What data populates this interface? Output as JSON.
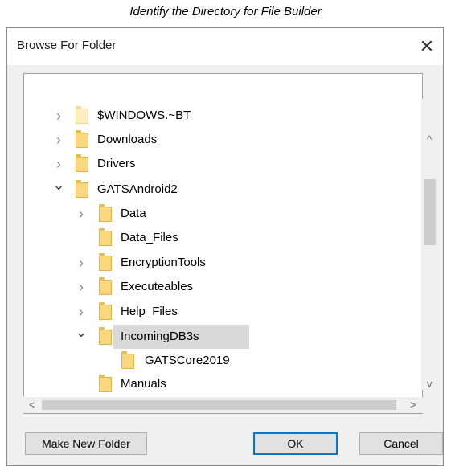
{
  "caption": "Identify the Directory for File Builder",
  "dialog": {
    "title": "Browse For Folder",
    "close_glyph": "✕"
  },
  "tree": {
    "items": [
      {
        "label": "$WINDOWS.~BT",
        "expander": "›"
      },
      {
        "label": "Downloads",
        "expander": "›"
      },
      {
        "label": "Drivers",
        "expander": "›"
      },
      {
        "label": "GATSAndroid2",
        "expander": "⌄"
      },
      {
        "label": "Data",
        "expander": "›"
      },
      {
        "label": "Data_Files",
        "expander": ""
      },
      {
        "label": "EncryptionTools",
        "expander": "›"
      },
      {
        "label": "Executeables",
        "expander": "›"
      },
      {
        "label": "Help_Files",
        "expander": "›"
      },
      {
        "label": "IncomingDB3s",
        "expander": "⌄"
      },
      {
        "label": "GATSCore2019",
        "expander": ""
      },
      {
        "label": "Manuals",
        "expander": ""
      }
    ],
    "selected": "GATSCore2019"
  },
  "scrollbars": {
    "up": "^",
    "down": "v",
    "left": "<",
    "right": ">"
  },
  "buttons": {
    "make_new_folder": "Make New Folder",
    "ok": "OK",
    "cancel": "Cancel"
  },
  "icons": {
    "folder": "folder-icon",
    "close": "close-icon",
    "expand": "chevron-right-icon",
    "collapse": "chevron-down-icon"
  },
  "colors": {
    "folder": "#f9d77e",
    "selection": "#d9d9d9",
    "default_button_border": "#0078d7"
  }
}
